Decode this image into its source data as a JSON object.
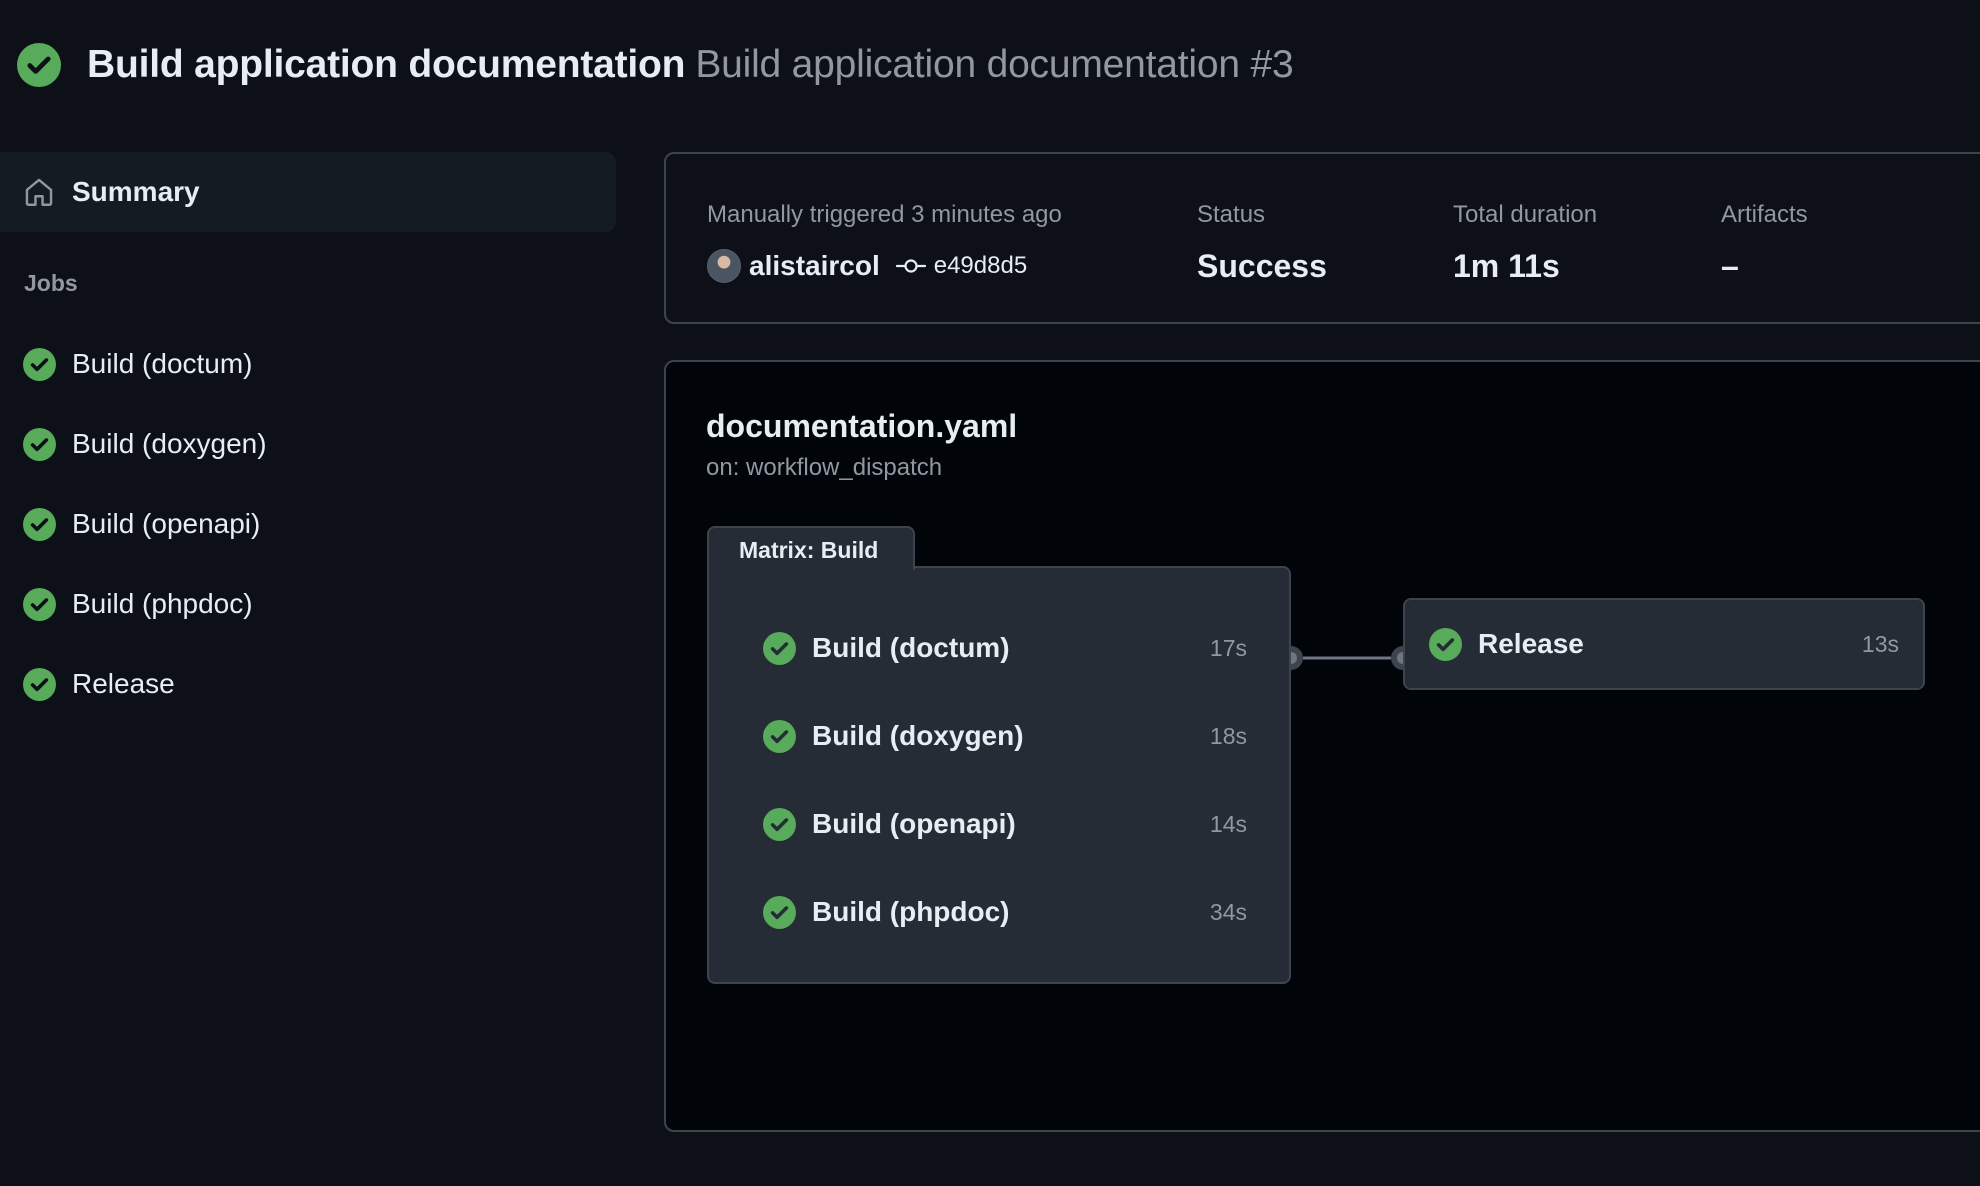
{
  "header": {
    "workflow_name": "Build application documentation",
    "run_title": "Build application documentation #3",
    "status_icon": "check-circle-icon",
    "status_color": "#57ab5a"
  },
  "sidebar": {
    "summary_label": "Summary",
    "summary_icon": "home-icon",
    "jobs_heading": "Jobs",
    "jobs": [
      {
        "label": "Build (doctum)"
      },
      {
        "label": "Build (doxygen)"
      },
      {
        "label": "Build (openapi)"
      },
      {
        "label": "Build (phpdoc)"
      },
      {
        "label": "Release"
      }
    ]
  },
  "summary": {
    "trigger_text": "Manually triggered 3 minutes ago",
    "actor": "alistaircol",
    "commit_sha": "e49d8d5",
    "status_label": "Status",
    "status_value": "Success",
    "duration_label": "Total duration",
    "duration_value": "1m 11s",
    "artifacts_label": "Artifacts",
    "artifacts_value": "–"
  },
  "graph": {
    "workflow_file": "documentation.yaml",
    "trigger": "on: workflow_dispatch",
    "matrix_label": "Matrix: Build",
    "matrix_jobs": [
      {
        "label": "Build (doctum)",
        "duration": "17s"
      },
      {
        "label": "Build (doxygen)",
        "duration": "18s"
      },
      {
        "label": "Build (openapi)",
        "duration": "14s"
      },
      {
        "label": "Build (phpdoc)",
        "duration": "34s"
      }
    ],
    "release_job": {
      "label": "Release",
      "duration": "13s"
    }
  },
  "colors": {
    "background": "#0d1117",
    "panel_border": "#3d444d",
    "success": "#57ab5a",
    "muted_text": "#9198a1"
  }
}
